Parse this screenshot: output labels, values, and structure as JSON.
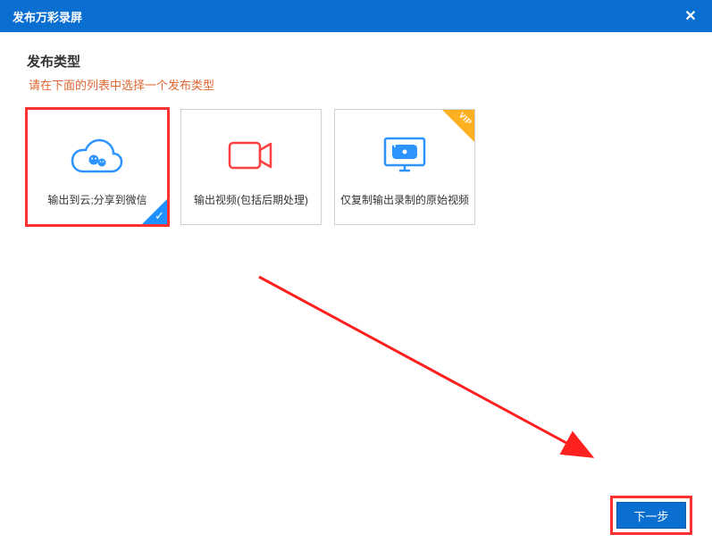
{
  "titlebar": {
    "title": "发布万彩录屏"
  },
  "section": {
    "title": "发布类型",
    "subtitle": "请在下面的列表中选择一个发布类型"
  },
  "options": [
    {
      "label": "输出到云;分享到微信",
      "selected": true,
      "vip": false
    },
    {
      "label": "输出视频(包括后期处理)",
      "selected": false,
      "vip": false
    },
    {
      "label": "仅复制输出录制的原始视频",
      "selected": false,
      "vip": true
    }
  ],
  "vip_badge": "VIP",
  "footer": {
    "next": "下一步"
  }
}
